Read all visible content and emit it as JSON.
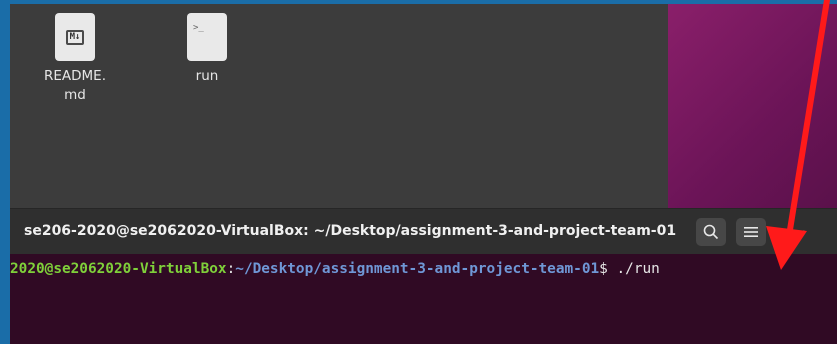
{
  "desktop": {
    "files": [
      {
        "name": "README.\nmd",
        "line1": "README.",
        "line2": "md",
        "icon": "markdown-file-icon",
        "glyph": "M↓"
      },
      {
        "name": "run",
        "line1": "run",
        "icon": "terminal-script-icon",
        "glyph": ">_"
      }
    ]
  },
  "terminal": {
    "title": "se206-2020@se2062020-VirtualBox: ~/Desktop/assignment-3-and-project-team-01",
    "search_icon": "search-icon",
    "menu_icon": "hamburger-menu-icon",
    "minimize_label": "–",
    "prompt_user": "2020@se2062020-VirtualBox",
    "prompt_colon": ":",
    "prompt_path": "~/Desktop/assignment-3-and-project-team-01",
    "prompt_symbol": "$ ",
    "command": "./run"
  },
  "colors": {
    "annotation_arrow": "#ff0000",
    "terminal_bg": "#300a24",
    "prompt_user": "#7fd03a",
    "prompt_path": "#6f97d6"
  }
}
